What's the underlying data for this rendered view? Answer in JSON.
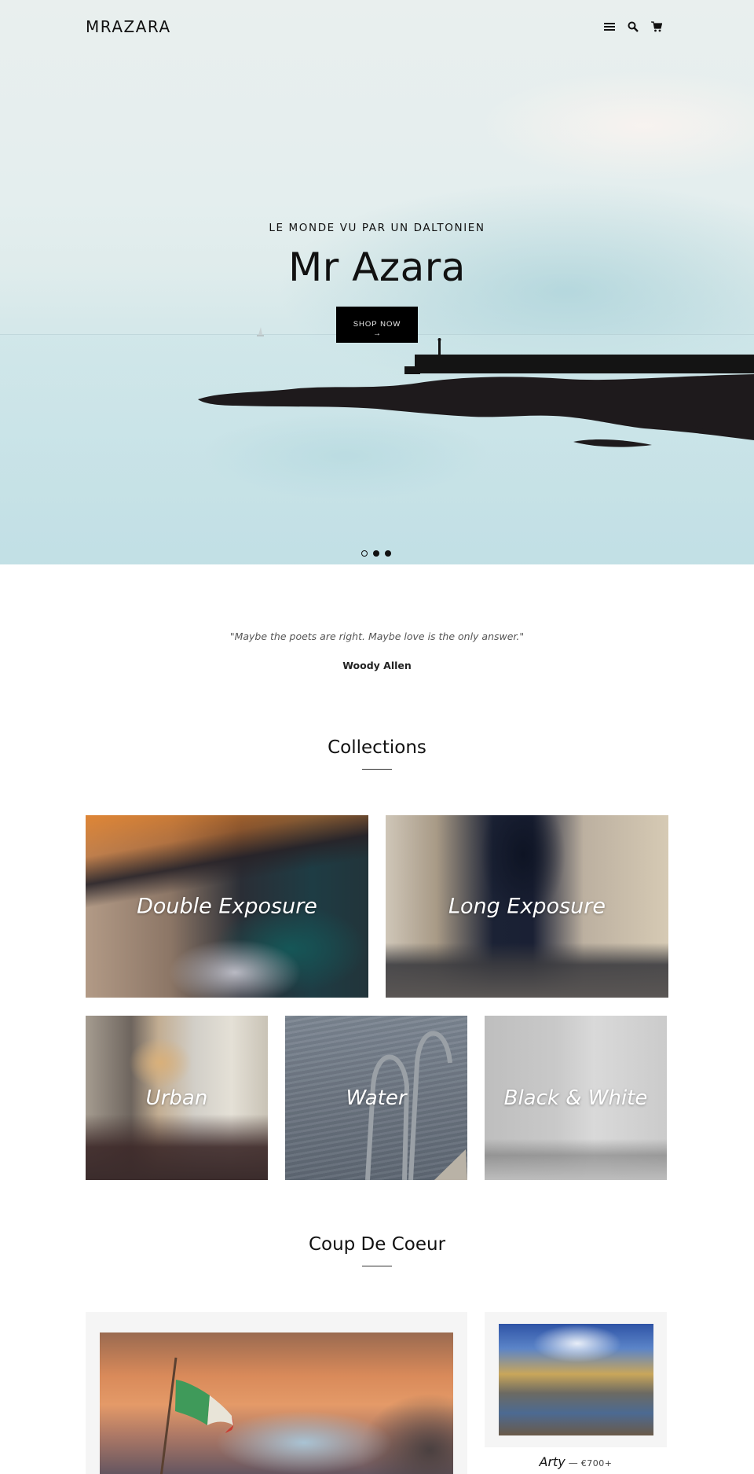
{
  "header": {
    "logo": "MRAZARA",
    "icons": [
      "menu-icon",
      "search-icon",
      "cart-icon"
    ]
  },
  "hero": {
    "subtitle": "LE MONDE VU PAR UN DALTONIEN",
    "title": "Mr Azara",
    "cta_label": "SHOP NOW",
    "cta_arrow": "→",
    "slides": [
      {
        "active": true
      },
      {
        "active": false
      },
      {
        "active": false
      }
    ]
  },
  "quote": {
    "text": "\"Maybe the poets are right. Maybe love is the only answer.\"",
    "author": "Woody Allen"
  },
  "collections": {
    "heading": "Collections",
    "items": [
      {
        "label": "Double Exposure"
      },
      {
        "label": "Long Exposure"
      },
      {
        "label": "Urban"
      },
      {
        "label": "Water"
      },
      {
        "label": "Black & White"
      }
    ]
  },
  "featured": {
    "heading": "Coup De Coeur",
    "products": [
      {
        "name": "",
        "price": ""
      },
      {
        "name": "Arty",
        "separator": "—",
        "price": "€700+"
      }
    ]
  },
  "colors": {
    "text": "#111111",
    "button_bg": "#000000",
    "card_bg": "#f5f5f5",
    "quote_text": "#555555"
  }
}
